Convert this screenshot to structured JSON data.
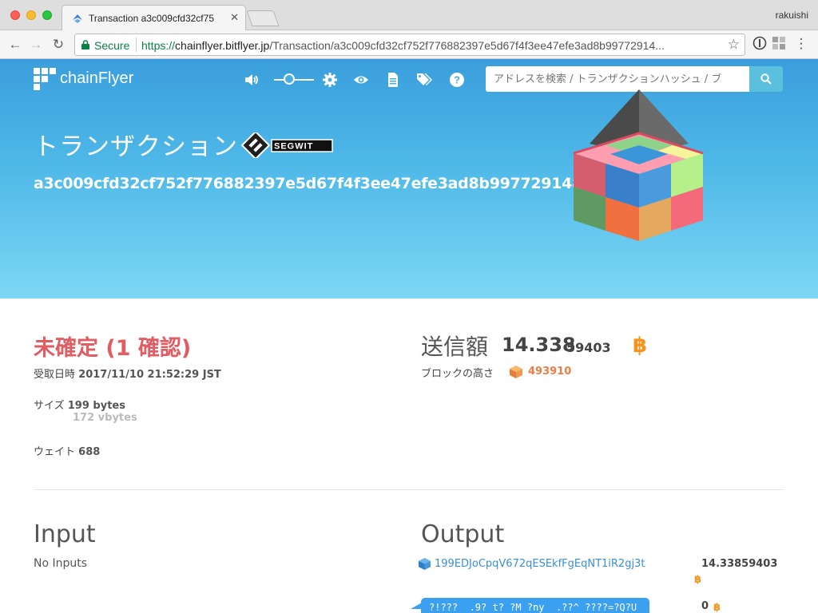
{
  "browser": {
    "tab_title": "Transaction a3c009cfd32cf75",
    "profile": "rakuishi",
    "secure_label": "Secure",
    "url_scheme": "https://",
    "url_host": "chainflyer.bitflyer.jp",
    "url_path": "/Transaction/a3c009cfd32cf752f776882397e5d67f4f3ee47efe3ad8b99772914..."
  },
  "header": {
    "logo": "chainFlyer",
    "search_placeholder": "アドレスを検索 / トランザクションハッシュ / ブ",
    "icons": [
      "volume-icon",
      "slider-icon",
      "gear-icon",
      "eye-icon",
      "document-icon",
      "tags-icon",
      "help-icon",
      "search-icon"
    ]
  },
  "hero": {
    "title": "トランザクション",
    "badge": "SEGWIT",
    "hash": "a3c009cfd32cf752f776882397e5d67f4f3ee47efe3ad8b99772914870f178b5"
  },
  "tx": {
    "status": "未確定 (1 確認)",
    "received_label": "受取日時",
    "received_value": "2017/11/10 21:52:29 JST",
    "size_label": "サイズ",
    "size_value": "199 bytes",
    "vsize_value": "172 vbytes",
    "weight_label": "ウェイト",
    "weight_value": "688",
    "amount_label": "送信額",
    "amount_main": "14.338",
    "amount_small": "59403",
    "block_label": "ブロックの高さ",
    "block_value": "493910"
  },
  "inputs": {
    "heading": "Input",
    "empty": "No Inputs"
  },
  "outputs": {
    "heading": "Output",
    "rows": [
      {
        "address": "199EDJoCpqV672qESEkfFgEqNT1iR2gj3t",
        "amount": "14.33859403"
      },
      {
        "address": "?!???  .9? t? ?M ?ny  .??^ ????=?Q?U",
        "amount": "0"
      }
    ]
  },
  "colors": {
    "status_red": "#e25d63",
    "block_orange": "#ee7d45",
    "link_blue": "#3a8fd4",
    "bitcoin_orange": "#f7931a"
  }
}
